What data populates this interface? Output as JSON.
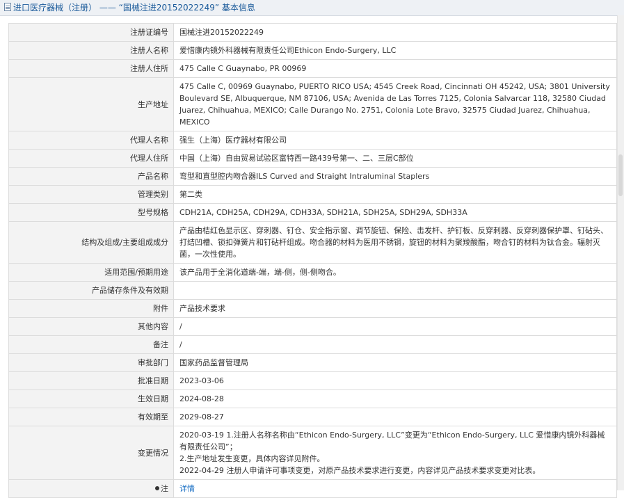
{
  "header": {
    "category": "进口医疗器械（注册）",
    "separator": " —— ",
    "title": "“国械注进20152022249” 基本信息"
  },
  "rows": [
    {
      "key": "reg_no",
      "label": "注册证编号",
      "value": "国械注进20152022249"
    },
    {
      "key": "registrant",
      "label": "注册人名称",
      "value": "爱惜康内镜外科器械有限责任公司Ethicon Endo-Surgery, LLC"
    },
    {
      "key": "registrant_address",
      "label": "注册人住所",
      "value": "475 Calle C Guaynabo, PR 00969"
    },
    {
      "key": "production_address",
      "label": "生产地址",
      "value": "475 Calle C, 00969 Guaynabo, PUERTO RICO USA; 4545 Creek Road, Cincinnati OH 45242, USA; 3801 University Boulevard SE, Albuquerque, NM 87106, USA; Avenida de Las Torres 7125, Colonia Salvarcar 118, 32580 Ciudad Juarez, Chihuahua, MEXICO; Calle Durango No. 2751, Colonia Lote Bravo, 32575 Ciudad Juarez, Chihuahua, MEXICO"
    },
    {
      "key": "agent",
      "label": "代理人名称",
      "value": "强生（上海）医疗器材有限公司"
    },
    {
      "key": "agent_address",
      "label": "代理人住所",
      "value": "中国（上海）自由贸易试验区富特西一路439号第一、二、三层C部位"
    },
    {
      "key": "product_name",
      "label": "产品名称",
      "value": "弯型和直型腔内吻合器ILS Curved and Straight Intraluminal Staplers"
    },
    {
      "key": "class",
      "label": "管理类别",
      "value": "第二类"
    },
    {
      "key": "models",
      "label": "型号规格",
      "value": "CDH21A, CDH25A, CDH29A, CDH33A, SDH21A, SDH25A, SDH29A, SDH33A"
    },
    {
      "key": "structure",
      "label": "结构及组成/主要组成成分",
      "value": "产品由桔红色显示区、穿刺器、钉仓、安全指示窗、调节旋钮、保险、击发杆、护钉板、反穿刺器、反穿刺器保护罩、钉砧头、打结凹槽、锁扣弹簧片和钉砧杆组成。吻合器的材料为医用不锈钢，旋钮的材料为聚羧酸酯，吻合钉的材料为钛合金。辐射灭菌，一次性使用。"
    },
    {
      "key": "scope",
      "label": "适用范围/预期用途",
      "value": "该产品用于全消化道端-端，端-侧，侧-侧吻合。"
    },
    {
      "key": "storage",
      "label": "产品储存条件及有效期",
      "value": ""
    },
    {
      "key": "attachment",
      "label": "附件",
      "value": "产品技术要求"
    },
    {
      "key": "other",
      "label": "其他内容",
      "value": "/"
    },
    {
      "key": "remark",
      "label": "备注",
      "value": "/"
    },
    {
      "key": "approver",
      "label": "审批部门",
      "value": "国家药品监督管理局"
    },
    {
      "key": "approval_date",
      "label": "批准日期",
      "value": "2023-03-06"
    },
    {
      "key": "effective_date",
      "label": "生效日期",
      "value": "2024-08-28"
    },
    {
      "key": "expiry",
      "label": "有效期至",
      "value": "2029-08-27"
    }
  ],
  "changes": {
    "label": "变更情况",
    "lines": [
      "2020-03-19 1.注册人名称名称由“Ethicon Endo-Surgery, LLC”变更为“Ethicon Endo-Surgery, LLC 爱惜康内镜外科器械有限责任公司”；",
      "2.生产地址发生变更，具体内容详见附件。",
      "2022-04-29 注册人申请许可事项变更，对原产品技术要求进行变更，内容详见产品技术要求变更对比表。"
    ]
  },
  "note": {
    "label": "注",
    "link_text": "详情"
  },
  "colors": {
    "label_bg": "#f3f3f3",
    "border": "#dcdcdc",
    "link": "#1a6fc4",
    "header_text": "#1a5a9a"
  }
}
